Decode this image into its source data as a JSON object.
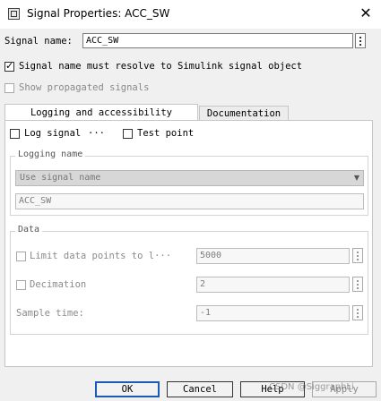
{
  "window": {
    "title": "Signal Properties: ACC_SW"
  },
  "signal_name": {
    "label": "Signal name:",
    "value": "ACC_SW"
  },
  "options": {
    "resolve_label": "Signal name must resolve to Simulink signal object",
    "resolve_checked": true,
    "propagated_label": "Show propagated signals",
    "propagated_checked": false
  },
  "tabs": [
    {
      "label": "Logging and accessibility",
      "active": true
    },
    {
      "label": "Documentation",
      "active": false
    }
  ],
  "logging": {
    "log_signal_label": "Log signal",
    "log_signal_more": "···",
    "test_point_label": "Test point",
    "logging_name_group": "Logging name",
    "name_mode": "Use signal name",
    "name_value": "ACC_SW"
  },
  "data": {
    "group_title": "Data",
    "limit_label": "Limit data points to l···",
    "limit_value": "5000",
    "decimation_label": "Decimation",
    "decimation_value": "2",
    "sample_time_label": "Sample time:",
    "sample_time_value": "-1"
  },
  "buttons": {
    "ok": "OK",
    "cancel": "Cancel",
    "help": "Help",
    "apply": "Apply"
  },
  "watermark": "CSDN @SiggraphLi"
}
